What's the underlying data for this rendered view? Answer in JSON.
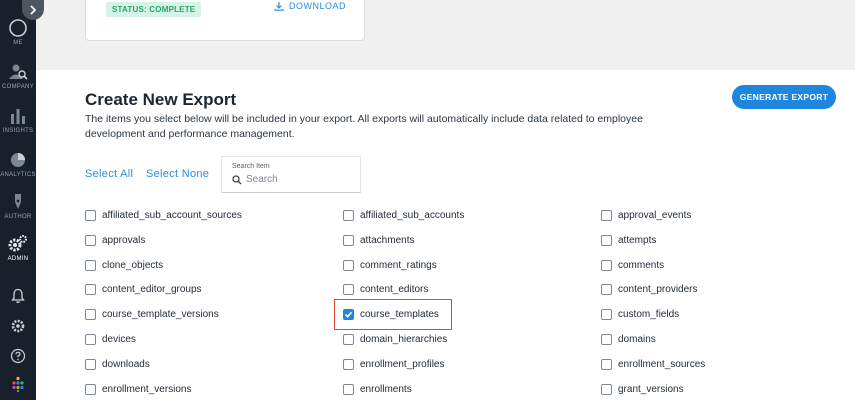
{
  "sidebar": {
    "items": [
      {
        "label": "ME",
        "icon": "user-circle-icon"
      },
      {
        "label": "COMPANY",
        "icon": "company-search-icon"
      },
      {
        "label": "INSIGHTS",
        "icon": "bar-chart-icon"
      },
      {
        "label": "ANALYTICS",
        "icon": "pie-chart-icon"
      },
      {
        "label": "AUTHOR",
        "icon": "pen-icon"
      },
      {
        "label": "ADMIN",
        "icon": "gears-icon"
      }
    ]
  },
  "top_card": {
    "status": "STATUS: COMPLETE",
    "download": "DOWNLOAD"
  },
  "export": {
    "title": "Create New Export",
    "description": "The items you select below will be included in your export. All exports will automatically include data related to employee development and performance management.",
    "generate_label": "GENERATE EXPORT",
    "select_all": "Select All",
    "select_none": "Select None",
    "search_label": "Search Item",
    "search_placeholder": "Search"
  },
  "items": [
    [
      "affiliated_sub_account_sources",
      "affiliated_sub_accounts",
      "approval_events"
    ],
    [
      "approvals",
      "attachments",
      "attempts"
    ],
    [
      "clone_objects",
      "comment_ratings",
      "comments"
    ],
    [
      "content_editor_groups",
      "content_editors",
      "content_providers"
    ],
    [
      "course_template_versions",
      "course_templates",
      "custom_fields"
    ],
    [
      "devices",
      "domain_hierarchies",
      "domains"
    ],
    [
      "downloads",
      "enrollment_profiles",
      "enrollment_sources"
    ],
    [
      "enrollment_versions",
      "enrollments",
      "grant_versions"
    ]
  ],
  "checked": [
    "course_templates"
  ],
  "colors": {
    "accent": "#1f86e0",
    "sidebar": "#18212b",
    "highlight": "#e0473a",
    "status": "#26a66b"
  }
}
